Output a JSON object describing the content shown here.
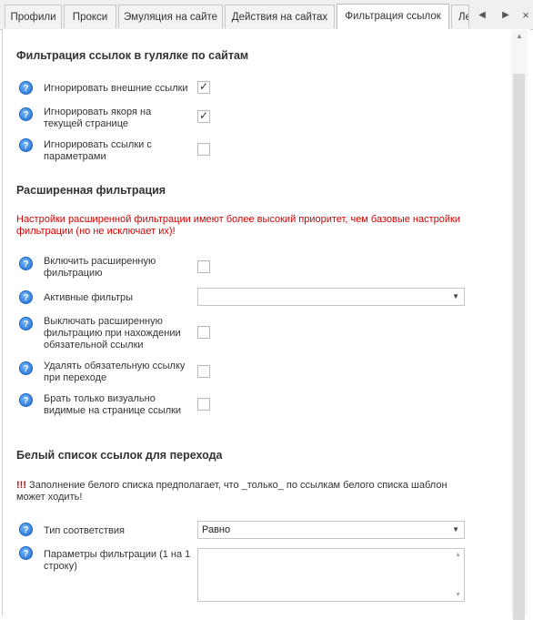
{
  "tabs": [
    {
      "label": "Профили"
    },
    {
      "label": "Прокси"
    },
    {
      "label": "Эмуляция на сайте"
    },
    {
      "label": "Действия на сайтах"
    },
    {
      "label": "Фильтрация ссылок"
    },
    {
      "label": "Ле"
    }
  ],
  "active_tab": "Фильтрация ссылок",
  "help_glyph": "?",
  "section1": {
    "title": "Фильтрация ссылок в гулялке по сайтам",
    "rows": [
      {
        "label": "Игнорировать внешние ссылки",
        "checked": true
      },
      {
        "label": "Игнорировать якоря на текущей странице",
        "checked": true
      },
      {
        "label": "Игнорировать ссылки с параметрами",
        "checked": false
      }
    ]
  },
  "section2": {
    "title": "Расширенная фильтрация",
    "warning": "Настройки расширенной фильтрации имеют более высокий приоритет, чем базовые настройки фильтрации (но не исключает их)!",
    "enable_label": "Включить расширенную фильтрацию",
    "enable_checked": false,
    "active_filters_label": "Активные фильтры",
    "active_filters_value": "",
    "rows": [
      {
        "label": "Выключать расширенную фильтрацию при нахождении обязательной ссылки",
        "checked": false
      },
      {
        "label": "Удалять обязательную ссылку при переходе",
        "checked": false
      },
      {
        "label": "Брать только визуально видимые на странице ссылки",
        "checked": false
      }
    ]
  },
  "section3": {
    "title": "Белый список ссылок для перехода",
    "note_marks": "!!!",
    "note_text": " Заполнение белого списка предполагает, что _только_ по ссылкам белого списка шаблон может ходить!",
    "match_type_label": "Тип соответствия",
    "match_type_value": "Равно",
    "params_label": "Параметры фильтрации (1 на 1 строку)",
    "params_value": ""
  }
}
